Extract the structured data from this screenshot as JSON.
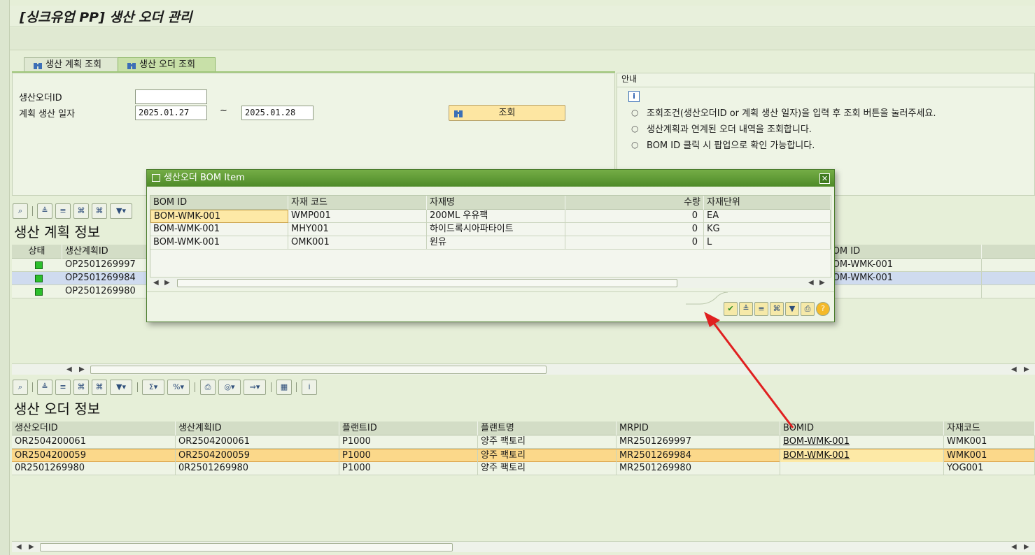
{
  "app_title": "[싱크유업 PP] 생산 오더 관리",
  "tabs": [
    {
      "label": "생산 계획 조회"
    },
    {
      "label": "생산 오더 조회"
    }
  ],
  "search": {
    "order_id_label": "생산오더ID",
    "order_id_value": "",
    "plan_date_label": "계획 생산 일자",
    "date_from": "2025.01.27",
    "date_sep": "~",
    "date_to": "2025.01.28",
    "query_button": "조회"
  },
  "info": {
    "title": "안내",
    "lines": [
      "조회조건(생산오더ID or 계획 생산 일자)을 입력 후 조회 버튼을 눌러주세요.",
      "생산계획과 연계된 오더 내역을 조회합니다.",
      "BOM ID 클릭 시 팝업으로 확인 가능합니다."
    ]
  },
  "plan_section": {
    "title": "생산 계획 정보",
    "headers": [
      "상태",
      "생산계획ID",
      "BOM ID"
    ],
    "rows": [
      {
        "plan_id": "OP2501269997",
        "bom": "BOM-WMK-001"
      },
      {
        "plan_id": "OP2501269984",
        "bom": "BOM-WMK-001"
      },
      {
        "plan_id": "OP2501269980",
        "bom": ""
      }
    ]
  },
  "order_section": {
    "title": "생산 오더 정보",
    "headers": [
      "생산오더ID",
      "생산계획ID",
      "플랜트ID",
      "플랜트명",
      "MRPID",
      "BOMID",
      "자재코드"
    ],
    "rows": [
      [
        "OR2504200061",
        "OR2504200061",
        "P1000",
        "양주 팩토리",
        "MR2501269997",
        "BOM-WMK-001",
        "WMK001"
      ],
      [
        "OR2504200059",
        "OR2504200059",
        "P1000",
        "양주 팩토리",
        "MR2501269984",
        "BOM-WMK-001",
        "WMK001"
      ],
      [
        "0R2501269980",
        "0R2501269980",
        "P1000",
        "양주 팩토리",
        "MR2501269980",
        "",
        "YOG001"
      ]
    ]
  },
  "popup": {
    "title": "생산오더 BOM Item",
    "headers": [
      "BOM ID",
      "자재 코드",
      "자재명",
      "수량",
      "자재단위"
    ],
    "rows": [
      [
        "BOM-WMK-001",
        "WMP001",
        "200ML 우유팩",
        "0",
        "EA"
      ],
      [
        "BOM-WMK-001",
        "MHY001",
        "하이드록시아파타이트",
        "0",
        "KG"
      ],
      [
        "BOM-WMK-001",
        "OMK001",
        "원유",
        "0",
        "L"
      ]
    ]
  },
  "colors": {
    "accent_green": "#4e8a28",
    "selected_row": "#fbd88a",
    "plan_selected_row": "#cfdbef",
    "arrow_red": "#e02020",
    "status_green": "#2cbf2c"
  }
}
